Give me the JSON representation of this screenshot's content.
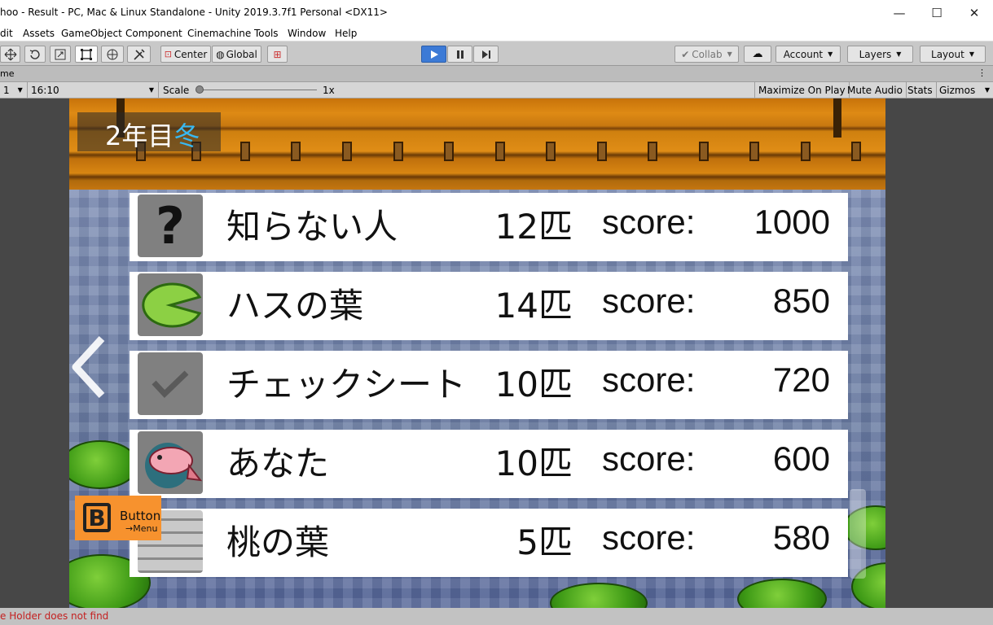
{
  "window": {
    "title": "hoo - Result - PC, Mac & Linux Standalone - Unity 2019.3.7f1 Personal <DX11>",
    "minimize": "—",
    "maximize": "☐",
    "close": "✕"
  },
  "menu": [
    "dit",
    "Assets",
    "GameObject",
    "Component",
    "Cinemachine",
    "Tools",
    "Window",
    "Help"
  ],
  "toolbar": {
    "center_label": "Center",
    "global_label": "Global",
    "collab_label": "Collab",
    "account_label": "Account",
    "layers_label": "Layers",
    "layout_label": "Layout"
  },
  "game_tab": {
    "label": "me",
    "more": "⋮"
  },
  "game_bar": {
    "display": "1",
    "aspect": "16:10",
    "scale_label": "Scale",
    "scale_value": "1x",
    "maximize_label": "Maximize On Play",
    "mute_label": "Mute Audio",
    "stats_label": "Stats",
    "gizmos_label": "Gizmos"
  },
  "game": {
    "year_text": "2年目",
    "season_text": "冬",
    "menu_button": {
      "letter": "B",
      "label": "Button",
      "sub": "→Menu"
    },
    "rows": [
      {
        "icon": "question-mark-icon",
        "name": "知らない人",
        "count": "12匹",
        "score_label": "score:",
        "score": "1000"
      },
      {
        "icon": "lily-pad-icon",
        "name": "ハスの葉",
        "count": "14匹",
        "score_label": "score:",
        "score": "850"
      },
      {
        "icon": "checkmark-icon",
        "name": "チェックシート",
        "count": "10匹",
        "score_label": "score:",
        "score": "720"
      },
      {
        "icon": "fish-icon",
        "name": "あなた",
        "count": "10匹",
        "score_label": "score:",
        "score": "600"
      },
      {
        "icon": "stone-wall-icon",
        "name": "桃の葉",
        "count": "5匹",
        "score_label": "score:",
        "score": "580"
      }
    ]
  },
  "status": {
    "message": "e Holder does not find"
  },
  "colors": {
    "season": "#39b8f0",
    "menu_button": "#f7922e",
    "status_text": "#c42020",
    "play_active": "#3c7ad6"
  }
}
